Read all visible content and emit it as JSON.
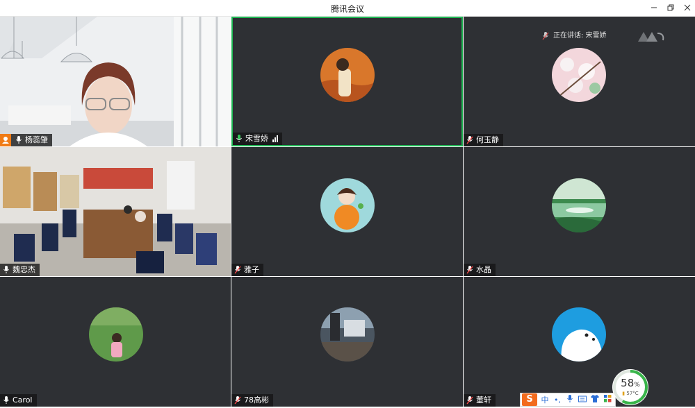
{
  "window": {
    "title": "腾讯会议",
    "minimize_icon": "minimize-icon",
    "restore_icon": "restore-icon",
    "close_icon": "close-icon"
  },
  "speaking_indicator": {
    "text": "正在讲话: 宋雪娇"
  },
  "participants": [
    {
      "name": "杨蕊肇",
      "mic": "on",
      "host": true
    },
    {
      "name": "宋雪娇",
      "mic": "on",
      "active": true,
      "signal": true
    },
    {
      "name": "何玉静",
      "mic": "muted"
    },
    {
      "name": "魏忠杰",
      "mic": "on"
    },
    {
      "name": "雅子",
      "mic": "muted"
    },
    {
      "name": "水晶",
      "mic": "muted"
    },
    {
      "name": "Carol",
      "mic": "on"
    },
    {
      "name": "78高彬",
      "mic": "muted"
    },
    {
      "name": "董轩",
      "mic": "muted"
    }
  ],
  "ime_toolbar": {
    "logo": "S",
    "mode": "中",
    "punct": "•,",
    "items": [
      "mic-icon",
      "keyboard-icon",
      "skin-icon",
      "apps-icon"
    ]
  },
  "system_gauge": {
    "percent": "58",
    "unit": "%",
    "temperature": "57°C"
  },
  "colors": {
    "active_border": "#1db552",
    "tile_bg": "#2e3034",
    "host_badge": "#f07b15",
    "ime_accent": "#2b6ed6"
  }
}
